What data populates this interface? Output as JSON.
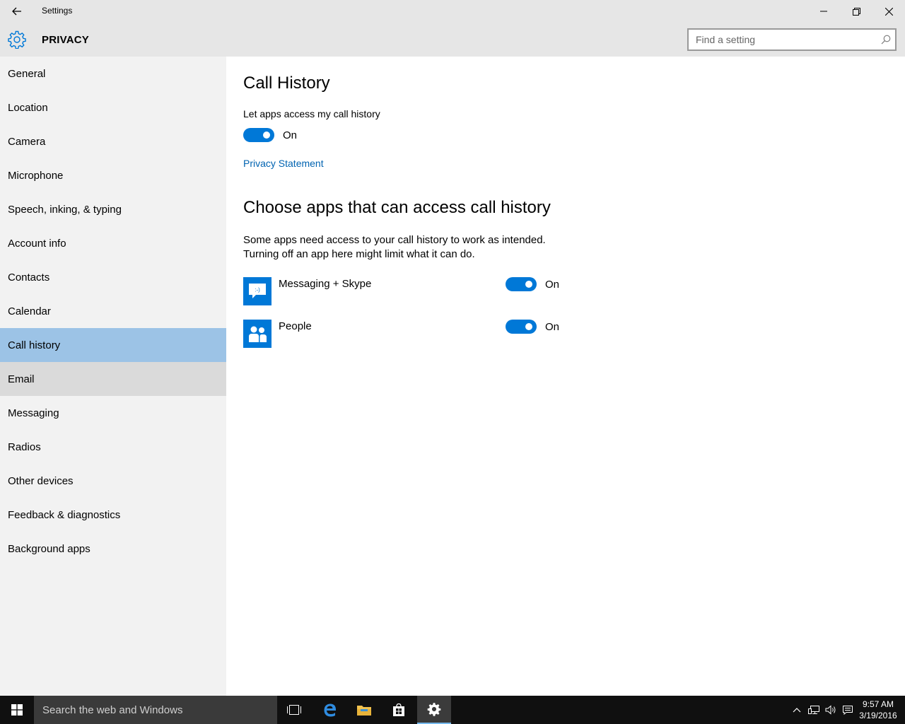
{
  "window": {
    "title": "Settings"
  },
  "header": {
    "title": "PRIVACY",
    "search_placeholder": "Find a setting"
  },
  "sidebar": {
    "items": [
      {
        "label": "General"
      },
      {
        "label": "Location"
      },
      {
        "label": "Camera"
      },
      {
        "label": "Microphone"
      },
      {
        "label": "Speech, inking, & typing"
      },
      {
        "label": "Account info"
      },
      {
        "label": "Contacts"
      },
      {
        "label": "Calendar"
      },
      {
        "label": "Call history"
      },
      {
        "label": "Email"
      },
      {
        "label": "Messaging"
      },
      {
        "label": "Radios"
      },
      {
        "label": "Other devices"
      },
      {
        "label": "Feedback & diagnostics"
      },
      {
        "label": "Background apps"
      }
    ],
    "selected": "Call history",
    "hovered": "Email"
  },
  "main": {
    "title": "Call History",
    "access_label": "Let apps access my call history",
    "access_toggle_state": "On",
    "privacy_link": "Privacy Statement",
    "apps_heading": "Choose apps that can access call history",
    "description_line1": "Some apps need access to your call history to work as intended.",
    "description_line2": "Turning off an app here might limit what it can do.",
    "apps": [
      {
        "name": "Messaging + Skype",
        "state": "On",
        "icon": "messaging-icon"
      },
      {
        "name": "People",
        "state": "On",
        "icon": "people-icon"
      }
    ]
  },
  "taskbar": {
    "search_placeholder": "Search the web and Windows",
    "time": "9:57 AM",
    "date": "3/19/2016"
  },
  "colors": {
    "accent": "#0078d7",
    "selected_nav": "#9cc3e6",
    "link": "#0063b1"
  }
}
